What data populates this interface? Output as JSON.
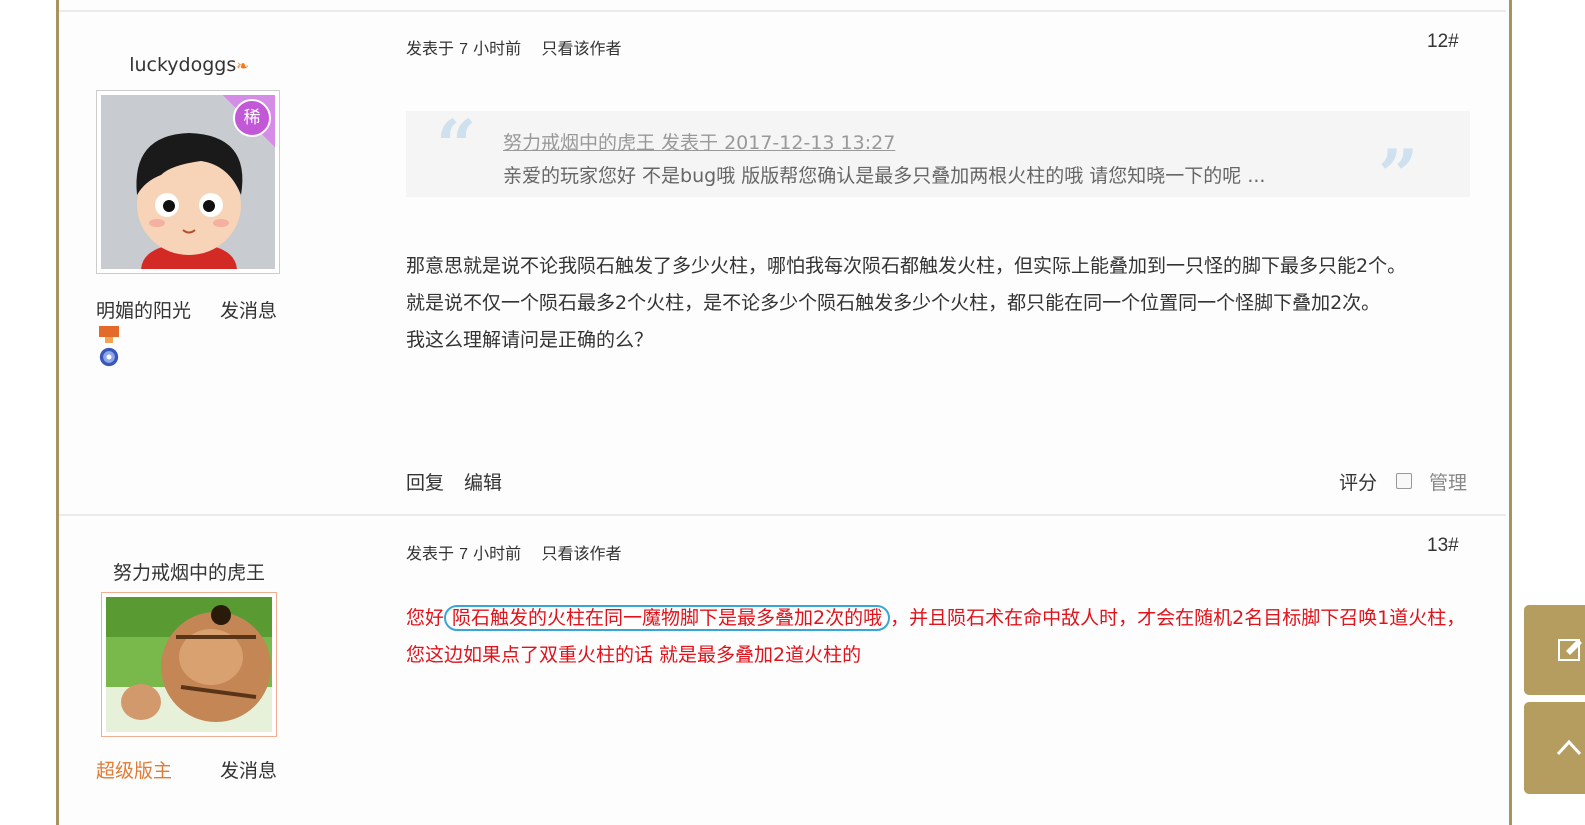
{
  "posts": [
    {
      "author": "luckydoggs",
      "author_role": "明媚的阳光",
      "send_msg": "发消息",
      "posted_prefix": "发表于",
      "posted_num": "7",
      "posted_suffix": "小时前",
      "only_author": "只看该作者",
      "floor": "12#",
      "avatar_badge": "稀",
      "quote": {
        "header": "努力戒烟中的虎王 发表于 2017-12-13 13:27",
        "text": "亲爱的玩家您好 不是bug哦 版版帮您确认是最多只叠加两根火柱的哦 请您知晓一下的呢 ..."
      },
      "body_lines": [
        "那意思就是说不论我陨石触发了多少火柱，哪怕我每次陨石都触发火柱，但实际上能叠加到一只怪的脚下最多只能2个。",
        "就是说不仅一个陨石最多2个火柱，是不论多少个陨石触发多少个火柱，都只能在同一个位置同一个怪脚下叠加2次。",
        "我这么理解请问是正确的么？"
      ],
      "reply": "回复",
      "edit": "编辑",
      "rate": "评分",
      "manage": "管理"
    },
    {
      "author": "努力戒烟中的虎王",
      "author_role": "超级版主",
      "send_msg": "发消息",
      "posted_prefix": "发表于",
      "posted_num": "7",
      "posted_suffix": "小时前",
      "only_author": "只看该作者",
      "floor": "13#",
      "body_pre": "您好",
      "body_circled": "陨石触发的火柱在同一魔物脚下是最多叠加2次的哦",
      "body_post": "，并且陨石术在命中敌人时，才会在随机2名目标脚下召唤1道火柱，您这边如果点了双重火柱的话 就是最多叠加2道火柱的"
    }
  ],
  "colors": {
    "frame": "#a99160",
    "mod_role": "#e07c35",
    "reply_red": "#e0131b",
    "circle": "#3aa6d4",
    "side_button": "#b59d5f"
  },
  "icons": [
    "medal-icon",
    "badge-icon",
    "edit-icon",
    "back-to-top-icon"
  ]
}
